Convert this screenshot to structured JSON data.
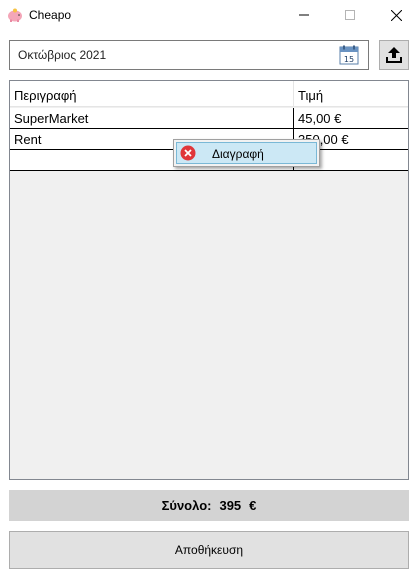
{
  "window": {
    "title": "Cheapo",
    "app_icon": "piggy-bank-icon",
    "controls": [
      "minimize-icon",
      "maximize-icon",
      "close-icon"
    ]
  },
  "month_picker": {
    "value": "Οκτώβριος 2021",
    "calendar_icon": "calendar-icon",
    "calendar_day": "15"
  },
  "export_button": {
    "icon": "upload-icon"
  },
  "grid": {
    "columns": [
      "Περιγραφή",
      "Τιμή"
    ],
    "rows": [
      {
        "description": "SuperMarket",
        "price": "45,00 €"
      },
      {
        "description": "Rent",
        "price": "350,00 €"
      },
      {
        "description": "",
        "price": ""
      }
    ]
  },
  "context_menu": {
    "items": [
      {
        "label": "Διαγραφή",
        "icon": "delete-icon"
      }
    ]
  },
  "total": {
    "label": "Σύνολο:",
    "value": "395",
    "currency": "€"
  },
  "save_button": {
    "label": "Αποθήκευση"
  },
  "colors": {
    "menu_highlight": "#cce8f5",
    "total_bg": "#d3d3d3",
    "delete_red": "#e0363a"
  }
}
